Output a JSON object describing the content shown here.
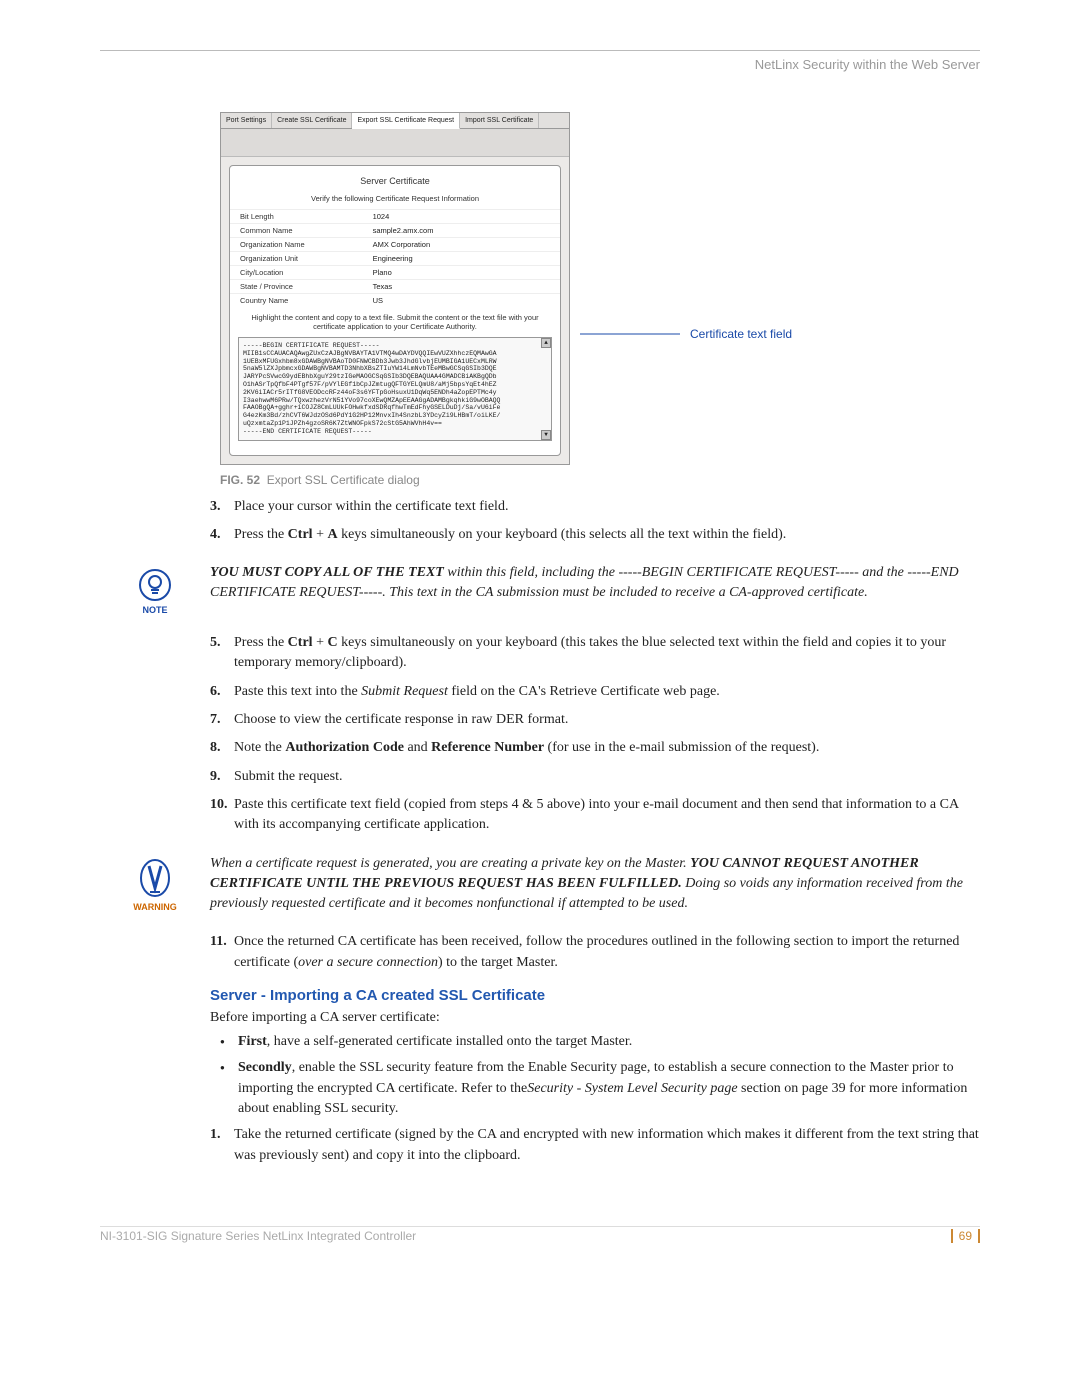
{
  "header": {
    "section": "NetLinx Security within the Web Server"
  },
  "dialog": {
    "tabs": [
      "Port Settings",
      "Create SSL Certificate",
      "Export SSL Certificate Request",
      "Import SSL Certificate"
    ],
    "title": "Server Certificate",
    "subtitle": "Verify the following Certificate Request Information",
    "rows": [
      {
        "label": "Bit Length",
        "value": "1024"
      },
      {
        "label": "Common Name",
        "value": "sample2.amx.com"
      },
      {
        "label": "Organization Name",
        "value": "AMX Corporation"
      },
      {
        "label": "Organization Unit",
        "value": "Engineering"
      },
      {
        "label": "City/Location",
        "value": "Plano"
      },
      {
        "label": "State / Province",
        "value": "Texas"
      },
      {
        "label": "Country Name",
        "value": "US"
      }
    ],
    "instruction": "Highlight the content and copy to a text file. Submit the content or the text file with your certificate application to your Certificate Authority.",
    "textarea": "-----BEGIN CERTIFICATE REQUEST-----\nMIIB1sCCAUACAQAwgZUxCzAJBgNVBAYTA1VTMQ4wDAYDVQQIEwVUZXhhczEQMAwGA\n1UEBxMFUGxhbm8xGDAWBgNVBAoTD0FNWCBDb3Jwb3JhdGlvbjEUMBIGA1UECxMLRW\n5naW5lZXJpbmcxGDAWBgNVBAMTD3NhbXBsZTIuYW14LmNvbTEeMBwGCSqGSIb3DQE\nJARYPcSVwcG9ydEBhbXguY29tzIGeMAOGCSqGSIb3DQEBAQUAA4GMADCBiAKBgQDb\nO1hASrTpQfbF4PTgf57F/pVYlEGf1bCpJZmtugQFTGYELQmU8/aMj5bpsYqEt4hEZ\n2KV6iIACr5rITfG8VEODccRFz44oF3s6YFTpGoHsuxU1DqWq5ENDh4aZopEPTMc4y\nI3aehwwM6PRw/TQxwzhezVrN51YVo97coXEwQMZApEEAAGgADAMBgkqhkiG9wOBAQQ\nFAAOBgQA+gghr+iCOJZ8CmLUUkFOHwkfxdSDRqfhwTmEdFhyGSELDuDj/Sa/vU6iFe\nG4ezKm3Bd/zhCVT6WJdzOSd6PdY1G2HP12MnvxIh4SnzbL3YDcyZi9LHBmT/oiLKE/\nuQzxmtaZp1P1JPZh4gzoSR6K7ZtWNOFpkS72cStG5AhWVhH4v==\n-----END CERTIFICATE REQUEST-----"
  },
  "callout": "Certificate text field",
  "caption": {
    "fig": "FIG. 52",
    "text": "Export SSL Certificate dialog"
  },
  "steps_a": [
    {
      "n": "3.",
      "text": "Place your cursor within the certificate text field."
    },
    {
      "n": "4.",
      "pre": "Press the ",
      "bold": "Ctrl",
      "mid": " + ",
      "bold2": "A",
      "post": " keys simultaneously on your keyboard (this selects all the text within the field)."
    }
  ],
  "note1": {
    "l1": "YOU MUST COPY ALL OF THE TEXT",
    "l1b": " within this field, including the -----BEGIN CERTIFICATE REQUEST-----",
    "l2": " and the ",
    "l2b": "-----END CERTIFICATE REQUEST-----. ",
    "l3": "This text in the CA submission must be included to receive a CA-approved certificate."
  },
  "steps_b": [
    {
      "n": "5.",
      "pre": "Press the ",
      "b1": "Ctrl",
      "mid": " + ",
      "b2": "C",
      "post": " keys simultaneously on your keyboard (this takes the blue selected text within the field and copies it to your temporary memory/clipboard)."
    },
    {
      "n": "6.",
      "pre": "Paste this text into the ",
      "i1": "Submit Request",
      "post": " field on the CA's Retrieve Certificate web page."
    },
    {
      "n": "7.",
      "text": "Choose to view the certificate response in raw DER format."
    },
    {
      "n": "8.",
      "pre": "Note the ",
      "b1": "Authorization Code",
      "mid": " and ",
      "b2": "Reference Number",
      "post": " (for use in the e-mail submission of the request)."
    },
    {
      "n": "9.",
      "text": "Submit the request."
    },
    {
      "n": "10.",
      "text": "Paste this certificate text field (copied from steps 4 & 5 above) into your e-mail document and then send that information to a CA with its accompanying certificate application."
    }
  ],
  "warn": {
    "l1": "When a certificate request is generated, you are creating a private key on the Master. ",
    "l2": "YOU CANNOT REQUEST ANOTHER CERTIFICATE UNTIL THE PREVIOUS REQUEST HAS BEEN FULFILLED.",
    "l3": " Doing so voids any information received from the previously requested certificate and it becomes nonfunctional if attempted to be used."
  },
  "steps_c": [
    {
      "n": "11.",
      "pre": "Once the returned CA certificate has been received, follow the procedures outlined in the following section to import the returned certificate (",
      "i1": "over a secure connection",
      "post": ") to the target Master."
    }
  ],
  "subhead": "Server - Importing a CA created SSL Certificate",
  "intro": "Before importing a CA server certificate:",
  "bullets": [
    {
      "b": "First",
      "t": ", have a self-generated certificate installed onto the target Master."
    },
    {
      "b": "Secondly",
      "t": ", enable the SSL security feature from the Enable Security page, to establish a secure connection to the Master prior to importing the encrypted CA certificate. Refer to the",
      "i": "Security - System Level Security page",
      "t2": " section on page 39 for more information about enabling SSL security."
    }
  ],
  "steps_d": [
    {
      "n": "1.",
      "text": "Take the returned certificate (signed by the CA and encrypted with new information which makes it different from the text string that was previously sent) and copy it into the clipboard."
    }
  ],
  "footer": {
    "doc": "NI-3101-SIG Signature Series NetLinx Integrated Controller",
    "page": "69"
  }
}
